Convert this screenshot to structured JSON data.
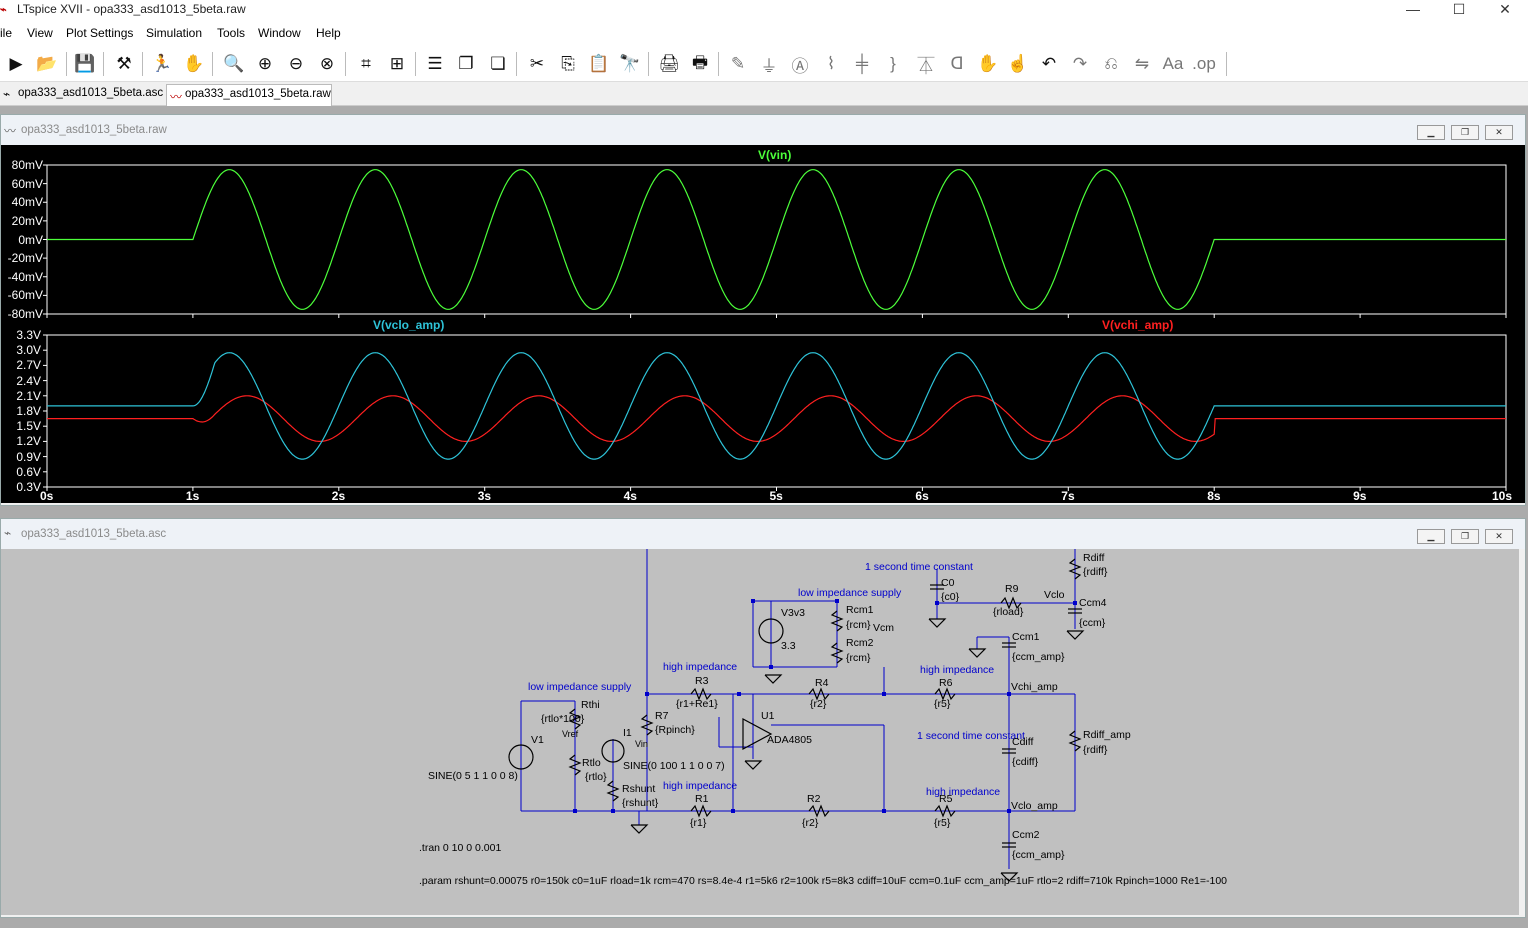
{
  "window": {
    "title": "LTspice XVII - opa333_asd1013_5beta.raw",
    "minimize": "—",
    "maximize": "☐",
    "close": "✕"
  },
  "menu": [
    "ile",
    "View",
    "Plot Settings",
    "Simulation",
    "Tools",
    "Window",
    "Help"
  ],
  "tabs": [
    {
      "label": "opa333_asd1013_5beta.asc",
      "icon": "schematic-icon"
    },
    {
      "label": "opa333_asd1013_5beta.raw",
      "icon": "waveform-icon"
    }
  ],
  "plot_window": {
    "title": "opa333_asd1013_5beta.raw"
  },
  "schematic_window": {
    "title": "opa333_asd1013_5beta.asc"
  },
  "chart_data": [
    {
      "type": "line",
      "title": "",
      "series": [
        {
          "name": "V(vin)",
          "color": "#4cff3a"
        }
      ],
      "yticks": [
        "80mV",
        "60mV",
        "40mV",
        "20mV",
        "0mV",
        "-20mV",
        "-40mV",
        "-60mV",
        "-80mV"
      ],
      "ylim": [
        -80,
        80
      ],
      "xlim": [
        0,
        10
      ],
      "signal": {
        "start_s": 1,
        "stop_s": 8,
        "freq_hz": 1,
        "amplitude_mV": 75,
        "offset_mV": 0
      }
    },
    {
      "type": "line",
      "title": "",
      "series": [
        {
          "name": "V(vclo_amp)",
          "color": "#2ec3d8",
          "baseline_V": 1.9,
          "amplitude_V": 1.05,
          "delay_s": 0,
          "end_value_V": 1.9
        },
        {
          "name": "V(vchi_amp)",
          "color": "#ff2020",
          "baseline_V": 1.65,
          "amplitude_V": 0.45,
          "delay_s": 0.12,
          "end_value_V": 1.65
        }
      ],
      "yticks": [
        "3.3V",
        "3.0V",
        "2.7V",
        "2.4V",
        "2.1V",
        "1.8V",
        "1.5V",
        "1.2V",
        "0.9V",
        "0.6V",
        "0.3V"
      ],
      "ylim": [
        0.3,
        3.3
      ],
      "xticks": [
        "0s",
        "1s",
        "2s",
        "3s",
        "4s",
        "5s",
        "6s",
        "7s",
        "8s",
        "9s",
        "10s"
      ],
      "xlim": [
        0,
        10
      ],
      "grid": false
    }
  ],
  "schematic": {
    "labels": {
      "one_second_tc_top": "1 second time constant",
      "c0": "C0",
      "c0v": "{c0}",
      "r9": "R9",
      "r9v": "{rload}",
      "vclo": "Vclo",
      "rdiff": "Rdiff",
      "rdiffv": "{rdiff}",
      "ccm4": "Ccm4",
      "ccm4v": "{ccm}",
      "low_imp_supply_top": "low impedance supply",
      "v3v3": "V3v3",
      "v3v3v": "3.3",
      "rcm1": "Rcm1",
      "rcm1v": "{rcm}",
      "vcm": "Vcm",
      "rcm2": "Rcm2",
      "rcm2v": "{rcm}",
      "ccm1": "Ccm1",
      "ccm1v": "{ccm_amp}",
      "high_imp_1": "high impedance",
      "high_imp_2": "high impedance",
      "high_imp_3": "high impedance",
      "high_imp_4": "high impedance",
      "low_imp_supply_left": "low impedance supply",
      "r3": "R3",
      "r3v": "{r1+Re1}",
      "r4": "R4",
      "r4v": "{r2}",
      "r6": "R6",
      "r6v": "{r5}",
      "vchi_amp": "Vchi_amp",
      "rthi": "Rthi",
      "rthiv": "{rtlo*100}",
      "r7": "R7",
      "r7v": "{Rpinch}",
      "i1": "I1",
      "u1": "U1",
      "ada": "ADA4805",
      "vin": "Vin",
      "vref": "Vref",
      "v1": "V1",
      "v1v": "SINE(0 5 1 1 0 0 8)",
      "rtlo": "Rtlo",
      "rtlov": "{rtlo}",
      "i1v": "SINE(0 100 1 1 0 0 7)",
      "one_second_tc_mid": "1 second time constant",
      "cdiff": "Cdiff",
      "cdiffv": "{cdiff}",
      "rdiff_amp": "Rdiff_amp",
      "rdiff_ampv": "{rdiff}",
      "rshunt": "Rshunt",
      "rshuntv": "{rshunt}",
      "r1": "R1",
      "r1v": "{r1}",
      "r2": "R2",
      "r2v": "{r2}",
      "r5": "R5",
      "r5v": "{r5}",
      "vclo_amp": "Vclo_amp",
      "ccm2": "Ccm2",
      "ccm2v": "{ccm_amp}",
      "tran": ".tran 0 10 0 0.001",
      "param": ".param rshunt=0.00075 r0=150k c0=1uF rload=1k rcm=470 rs=8.4e-4 r1=5k6 r2=100k r5=8k3 cdiff=10uF ccm=0.1uF ccm_amp=1uF rtlo=2 rdiff=710k Rpinch=1000 Re1=-100"
    }
  }
}
